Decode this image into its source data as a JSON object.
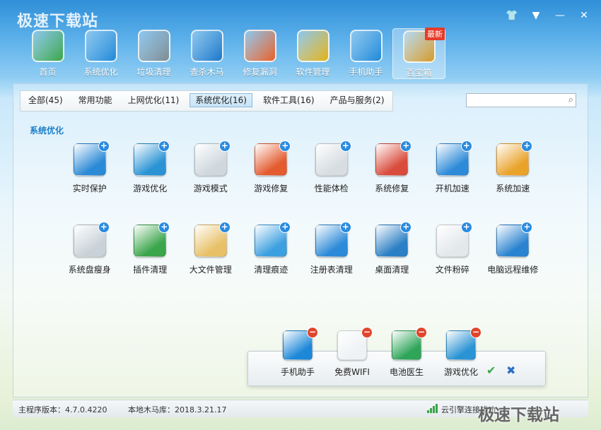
{
  "window": {
    "watermark": "极速下载站",
    "controls": [
      {
        "name": "skin-icon",
        "glyph": "👕"
      },
      {
        "name": "menu-icon",
        "glyph": "▼"
      },
      {
        "name": "minimize-icon",
        "glyph": "—"
      },
      {
        "name": "close-icon",
        "glyph": "✕"
      }
    ]
  },
  "toolbar": [
    {
      "label": "首页",
      "icon": "home-icon",
      "color": "#3aa54a"
    },
    {
      "label": "系统优化",
      "icon": "monitor-icon",
      "color": "#1e88d8"
    },
    {
      "label": "垃圾清理",
      "icon": "trash-icon",
      "color": "#7c8b93"
    },
    {
      "label": "查杀木马",
      "icon": "radar-icon",
      "color": "#1976c8"
    },
    {
      "label": "修复漏洞",
      "icon": "shield-fix-icon",
      "color": "#e5602a"
    },
    {
      "label": "软件管理",
      "icon": "software-icon",
      "color": "#e2b21a"
    },
    {
      "label": "手机助手",
      "icon": "phone-assistant-icon",
      "color": "#1e88d8"
    },
    {
      "label": "百宝箱",
      "icon": "toolbox-icon",
      "color": "#d69a2a",
      "badge": "最新",
      "active": true
    }
  ],
  "tabs": [
    {
      "label": "全部(45)",
      "active": false
    },
    {
      "label": "常用功能",
      "active": false
    },
    {
      "label": "上网优化(11)",
      "active": false
    },
    {
      "label": "系统优化(16)",
      "active": true
    },
    {
      "label": "软件工具(16)",
      "active": false
    },
    {
      "label": "产品与服务(2)",
      "active": false
    }
  ],
  "search": {
    "placeholder": ""
  },
  "section_title": "系统优化",
  "apps": [
    {
      "label": "实时保护",
      "icon": "realtime-protect-icon",
      "color": "#2b8ad6"
    },
    {
      "label": "游戏优化",
      "icon": "game-optimize-icon",
      "color": "#2a93d4"
    },
    {
      "label": "游戏模式",
      "icon": "gamepad-icon",
      "color": "#cfd8de"
    },
    {
      "label": "游戏修复",
      "icon": "game-repair-icon",
      "color": "#e45b2f"
    },
    {
      "label": "性能体检",
      "icon": "gauge-icon",
      "color": "#d7dde1"
    },
    {
      "label": "系统修复",
      "icon": "system-repair-icon",
      "color": "#d94b3b"
    },
    {
      "label": "开机加速",
      "icon": "boot-speedup-icon",
      "color": "#2c8ad8"
    },
    {
      "label": "系统加速",
      "icon": "windows-speedup-icon",
      "color": "#e9a32b"
    },
    {
      "label": "系统盘瘦身",
      "icon": "disk-slim-icon",
      "color": "#c9d2d8"
    },
    {
      "label": "插件清理",
      "icon": "puzzle-icon",
      "color": "#3aa54a"
    },
    {
      "label": "大文件管理",
      "icon": "folder-icon",
      "color": "#e8c067"
    },
    {
      "label": "清理痕迹",
      "icon": "eraser-icon",
      "color": "#3b9fe0"
    },
    {
      "label": "注册表清理",
      "icon": "registry-icon",
      "color": "#2c8ad8"
    },
    {
      "label": "桌面清理",
      "icon": "desktop-clean-icon",
      "color": "#2b7fc4"
    },
    {
      "label": "文件粉碎",
      "icon": "shredder-icon",
      "color": "#e3e8eb"
    },
    {
      "label": "电脑远程维修",
      "icon": "remote-repair-icon",
      "color": "#2a83d0"
    }
  ],
  "dock": {
    "apps": [
      {
        "label": "手机助手",
        "icon": "phone-assistant-icon",
        "color": "#1e88d8"
      },
      {
        "label": "免费WIFI",
        "icon": "wifi-icon",
        "color": "#eef2f4"
      },
      {
        "label": "电池医生",
        "icon": "battery-icon",
        "color": "#2fa55a"
      },
      {
        "label": "游戏优化",
        "icon": "game-optimize-icon",
        "color": "#2a93d4"
      }
    ],
    "ok_glyph": "✔",
    "cancel_glyph": "✖"
  },
  "status": {
    "version": "主程序版本：4.7.0.4220",
    "trojan_db": "本地木马库：2018.3.21.17",
    "cloud": "云引擎连接成功",
    "watermark": "极速下载站"
  }
}
